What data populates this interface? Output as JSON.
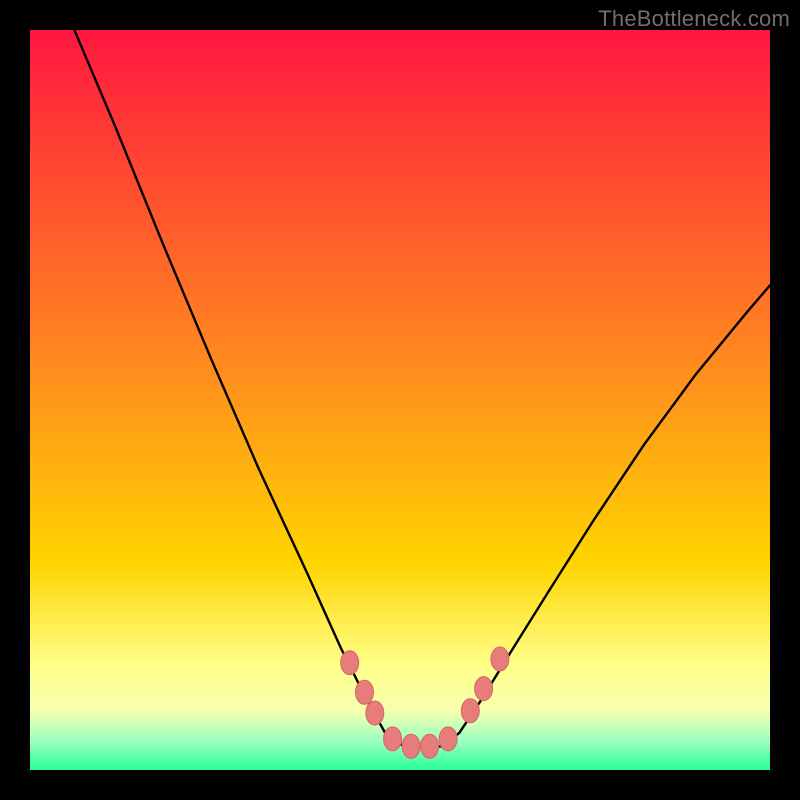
{
  "watermark": "TheBottleneck.com",
  "colors": {
    "frame": "#000000",
    "gradient_top": "#ff173f",
    "gradient_mid": "#ffd400",
    "gradient_yellow_band": "#ffff8a",
    "gradient_green": "#2bff9a",
    "curve": "#000000",
    "marker_fill": "#e77c7a",
    "marker_stroke": "#d66563"
  },
  "chart_data": {
    "type": "line",
    "title": "",
    "xlabel": "",
    "ylabel": "",
    "x_range": [
      0,
      100
    ],
    "y_range": [
      0,
      100
    ],
    "note": "Values are estimated from pixel positions relative to the 740×740 plot area. y=0 is the bottom (green), y=100 is the top (red). The curve is a V-shaped bottleneck plot with its minimum near x≈49–57 at y≈3.",
    "series": [
      {
        "name": "bottleneck-curve",
        "points": [
          {
            "x": 6.0,
            "y": 100.0
          },
          {
            "x": 11.5,
            "y": 87.0
          },
          {
            "x": 18.0,
            "y": 71.0
          },
          {
            "x": 24.5,
            "y": 55.5
          },
          {
            "x": 31.0,
            "y": 40.5
          },
          {
            "x": 37.5,
            "y": 26.5
          },
          {
            "x": 42.0,
            "y": 16.5
          },
          {
            "x": 45.5,
            "y": 9.5
          },
          {
            "x": 48.0,
            "y": 5.0
          },
          {
            "x": 50.5,
            "y": 3.2
          },
          {
            "x": 53.0,
            "y": 3.0
          },
          {
            "x": 55.5,
            "y": 3.2
          },
          {
            "x": 58.0,
            "y": 5.0
          },
          {
            "x": 61.0,
            "y": 9.5
          },
          {
            "x": 65.0,
            "y": 16.0
          },
          {
            "x": 70.0,
            "y": 24.0
          },
          {
            "x": 76.0,
            "y": 33.5
          },
          {
            "x": 83.0,
            "y": 44.0
          },
          {
            "x": 90.0,
            "y": 53.5
          },
          {
            "x": 97.0,
            "y": 62.0
          },
          {
            "x": 100.0,
            "y": 65.5
          }
        ]
      }
    ],
    "markers": [
      {
        "x": 43.2,
        "y": 14.5
      },
      {
        "x": 45.2,
        "y": 10.5
      },
      {
        "x": 46.6,
        "y": 7.7
      },
      {
        "x": 49.0,
        "y": 4.2
      },
      {
        "x": 51.5,
        "y": 3.2
      },
      {
        "x": 54.0,
        "y": 3.2
      },
      {
        "x": 56.5,
        "y": 4.2
      },
      {
        "x": 59.5,
        "y": 8.0
      },
      {
        "x": 61.3,
        "y": 11.0
      },
      {
        "x": 63.5,
        "y": 15.0
      }
    ]
  }
}
